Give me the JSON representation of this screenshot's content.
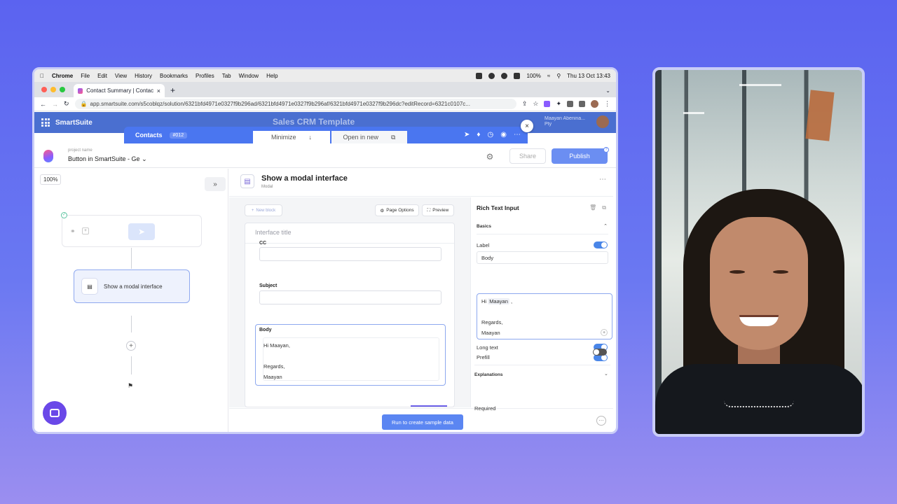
{
  "mac_menubar": {
    "app": "Chrome",
    "items": [
      "File",
      "Edit",
      "View",
      "History",
      "Bookmarks",
      "Profiles",
      "Tab",
      "Window",
      "Help"
    ],
    "battery": "100%",
    "datetime": "Thu 13 Oct 13:43"
  },
  "browser": {
    "tab_title": "Contact Summary | Contacts |",
    "url": "app.smartsuite.com/s5coblqz/solution/6321bfd4971e0327f9b296ad/6321bfd4971e0327f9b296af/6321bfd4971e0327f9b296dc?editRecord=6321c0107c..."
  },
  "smartsuite_header": {
    "brand": "SmartSuite",
    "solution_title": "Sales CRM Template",
    "user_name": "Maayan Abenina...",
    "user_sub": "Pty"
  },
  "record_bar": {
    "table": "Contacts",
    "record_id": "#012",
    "minimize_label": "Minimize",
    "open_new_label": "Open in new"
  },
  "automation_toolbar": {
    "project_label": "project name",
    "project_name": "Button in SmartSuite - Ge",
    "share_label": "Share",
    "publish_label": "Publish"
  },
  "canvas": {
    "zoom": "100%",
    "action_card_label": "Show a modal interface"
  },
  "step": {
    "title": "Show a modal interface",
    "subtitle": "Modal",
    "new_block_label": "New block",
    "page_options_label": "Page Options",
    "preview_label": "Preview"
  },
  "form": {
    "interface_title_placeholder": "Interface title",
    "cc_label": "CC",
    "subject_label": "Subject",
    "body_label": "Body",
    "body_lines": [
      "Hi Maayan,",
      "",
      "Regards,",
      "Maayan"
    ]
  },
  "footer": {
    "run_button": "Run to create sample data"
  },
  "right_panel": {
    "title": "Rich Text Input",
    "basics_label": "Basics",
    "label_label": "Label",
    "label_value": "Body",
    "long_text_label": "Long text",
    "prefill_label": "Prefill",
    "prefill_hi": "Hi",
    "prefill_mention": "Maayan",
    "prefill_comma": ",",
    "prefill_regards": "Regards,",
    "prefill_name": "Maayan",
    "required_label": "Required",
    "explanations_label": "Explanations",
    "toggles": {
      "label": true,
      "long_text": true,
      "prefill": true,
      "required": false
    }
  },
  "colors": {
    "accent": "#4a76f0",
    "header": "#4a6fd0",
    "publish": "#6b8ef2",
    "toggle_on": "#4a86e8",
    "intercom": "#6a48e8"
  }
}
